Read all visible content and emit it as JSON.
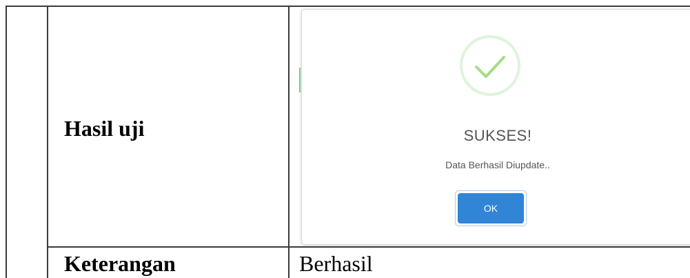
{
  "table": {
    "rows": [
      {
        "label": "Hasil uji",
        "value": ""
      },
      {
        "label": "Keterangan",
        "value": "Berhasil"
      }
    ]
  },
  "dialog": {
    "icon": "success-check-icon",
    "title": "SUKSES!",
    "message": "Data Berhasil Diupdate..",
    "ok_label": "OK"
  },
  "colors": {
    "check_green": "#a5dc86",
    "check_ring": "#dff3dc",
    "button_blue": "#3085d6",
    "dialog_text": "#545454"
  }
}
